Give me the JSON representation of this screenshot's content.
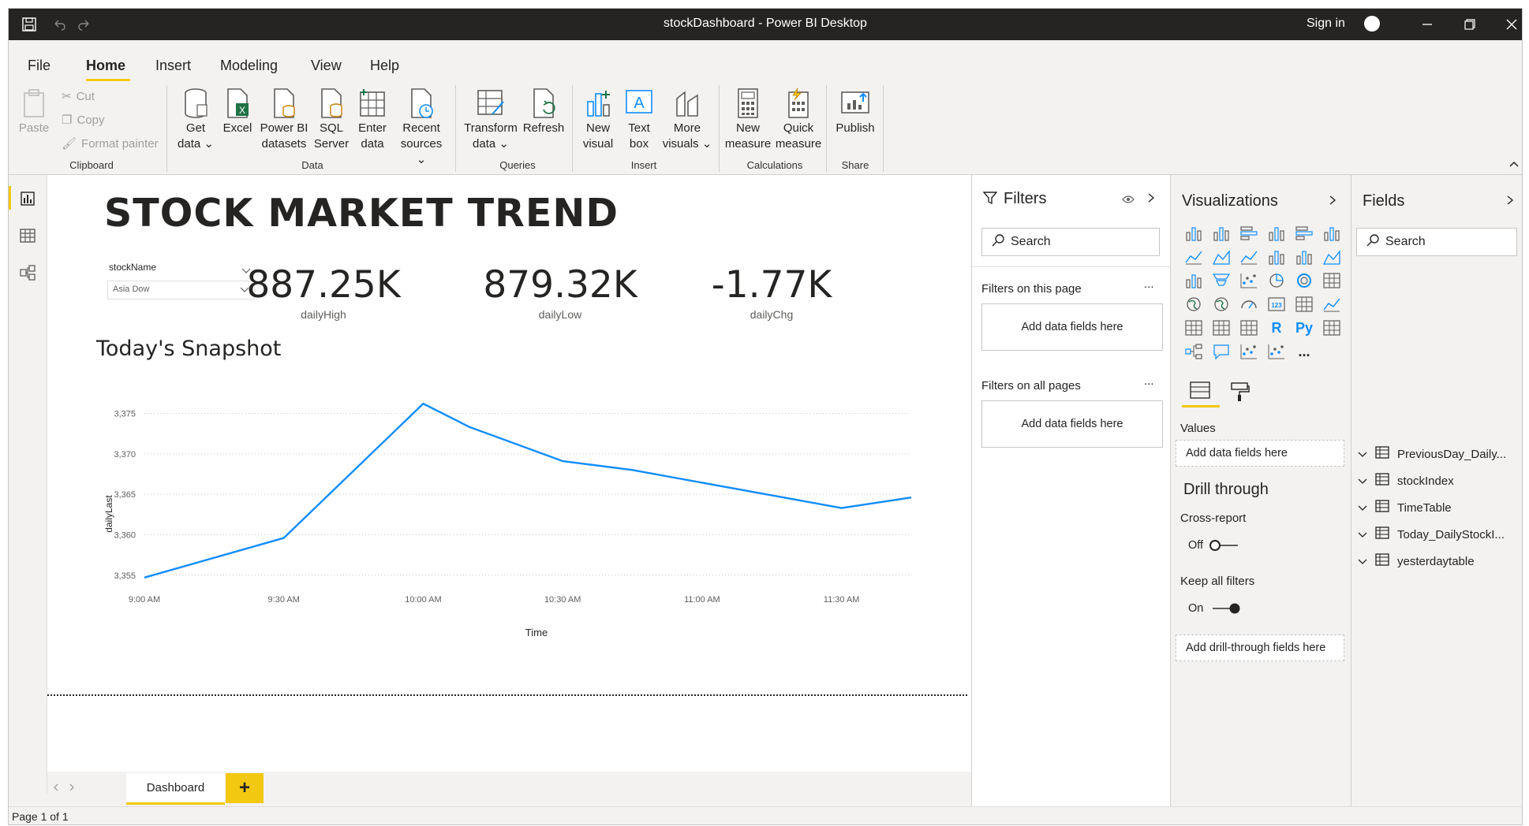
{
  "window": {
    "title": "stockDashboard - Power BI Desktop",
    "sign_in": "Sign in"
  },
  "menu": [
    "File",
    "Home",
    "Insert",
    "Modeling",
    "View",
    "Help"
  ],
  "ribbon": {
    "clipboard": {
      "paste": "Paste",
      "cut": "Cut",
      "copy": "Copy",
      "format_painter": "Format painter",
      "group": "Clipboard"
    },
    "data": {
      "get_data": "Get\ndata ⌄",
      "excel": "Excel",
      "pbi_datasets": "Power BI\ndatasets",
      "sql": "SQL\nServer",
      "enter": "Enter\ndata",
      "recent": "Recent\nsources ⌄",
      "group": "Data"
    },
    "queries": {
      "transform": "Transform\ndata ⌄",
      "refresh": "Refresh",
      "group": "Queries"
    },
    "insert": {
      "new_visual": "New\nvisual",
      "text_box": "Text\nbox",
      "more_visuals": "More\nvisuals ⌄",
      "group": "Insert"
    },
    "calculations": {
      "new_measure": "New\nmeasure",
      "quick_measure": "Quick\nmeasure",
      "group": "Calculations"
    },
    "share": {
      "publish": "Publish",
      "group": "Share"
    }
  },
  "report": {
    "title": "STOCK MARKET TREND",
    "slicer": {
      "label": "stockName",
      "value": "Asia Dow"
    },
    "kpis": [
      {
        "value": "887.25K",
        "caption": "dailyHigh"
      },
      {
        "value": "879.32K",
        "caption": "dailyLow"
      },
      {
        "value": "-1.77K",
        "caption": "dailyChg"
      }
    ],
    "snapshot_title": "Today's Snapshot"
  },
  "chart_data": {
    "type": "line",
    "xlabel": "Time",
    "ylabel": "dailyLast",
    "x_ticks": [
      "9:00 AM",
      "9:30 AM",
      "10:00 AM",
      "10:30 AM",
      "11:00 AM",
      "11:30 AM"
    ],
    "y_ticks": [
      "3,355",
      "3,360",
      "3,365",
      "3,370",
      "3,375"
    ],
    "ylim": [
      3355,
      3375
    ],
    "x_minutes": [
      0,
      30,
      60,
      70,
      90,
      105,
      150,
      165
    ],
    "series": [
      {
        "values": [
          3354.7,
          3359.6,
          3376.2,
          3373.3,
          3369.1,
          3368.0,
          3363.3,
          3364.6
        ],
        "color": "#118dff"
      }
    ]
  },
  "pages": {
    "tab": "Dashboard",
    "status": "Page 1 of 1"
  },
  "filters": {
    "title": "Filters",
    "search": "Search",
    "on_page": "Filters on this page",
    "on_all": "Filters on all pages",
    "add": "Add data fields here",
    "more": "..."
  },
  "visualizations": {
    "title": "Visualizations",
    "values_label": "Values",
    "values_add": "Add data fields here",
    "drill_title": "Drill through",
    "cross_report": "Cross-report",
    "off": "Off",
    "keep_filters": "Keep all filters",
    "on": "On",
    "drill_add": "Add drill-through fields here",
    "r": "R",
    "py": "Py",
    "ellipsis": "..."
  },
  "fields": {
    "title": "Fields",
    "search": "Search",
    "tables": [
      "PreviousDay_Daily...",
      "stockIndex",
      "TimeTable",
      "Today_DailyStockI...",
      "yesterdaytable"
    ]
  },
  "colors": {
    "accent": "#f2c811",
    "line": "#118dff",
    "titlebar": "#252423"
  }
}
